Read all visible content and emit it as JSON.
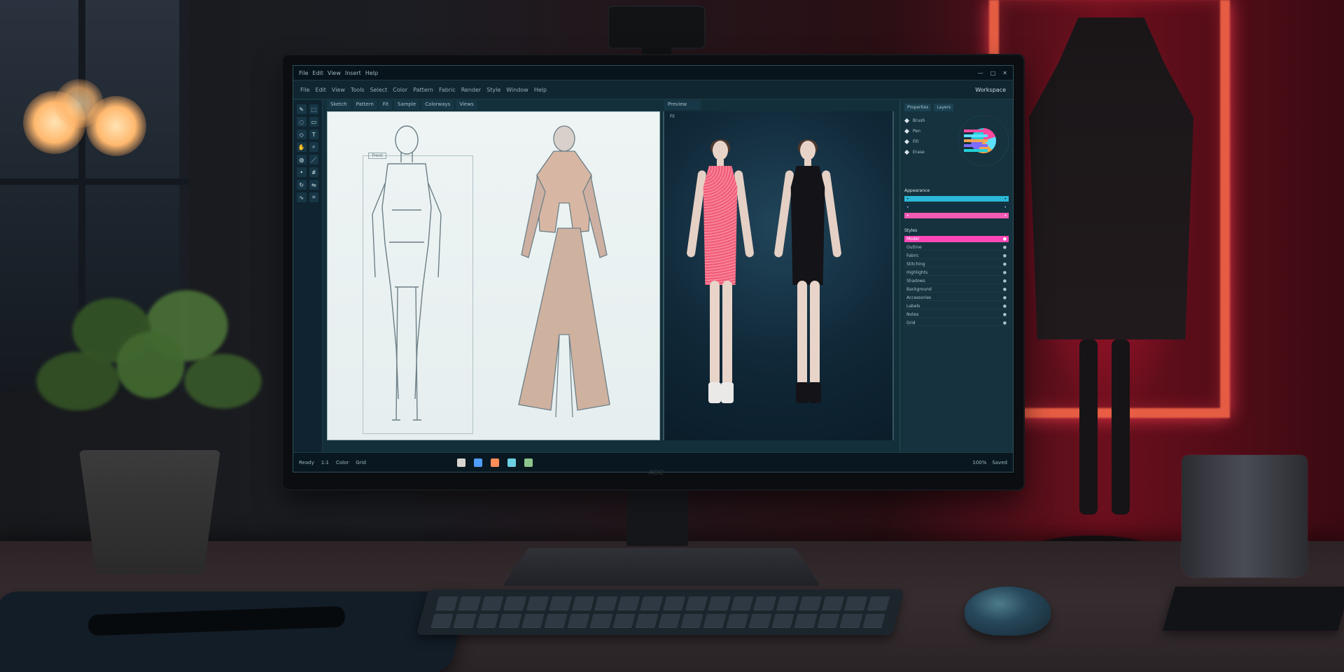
{
  "scene": {
    "accent_color": "#ff2f61",
    "screen_color": "#13303a"
  },
  "monitor": {
    "logo": "AOC"
  },
  "screen": {
    "titlebar": {
      "menu_items": [
        "File",
        "Edit",
        "View",
        "Insert",
        "Help"
      ],
      "window_controls": [
        "—",
        "□",
        "✕"
      ]
    },
    "toolbar": {
      "items": [
        "File",
        "Edit",
        "View",
        "Tools",
        "Select",
        "Color",
        "Pattern",
        "Fabric",
        "Render",
        "Style",
        "Window",
        "Help"
      ],
      "mode_label": "Workspace"
    },
    "tabs": [
      "Sketch",
      "Pattern",
      "Fit",
      "Sample",
      "Colorways",
      "Views"
    ],
    "preview_tab": "Preview",
    "sketch_label": "Front",
    "preview_label": "Fit",
    "right_panel": {
      "tabs": [
        "Properties",
        "Layers"
      ],
      "tools": [
        "Brush",
        "Pen",
        "Fill",
        "Erase"
      ],
      "section_a": "Appearance",
      "section_b": "Styles",
      "layers": [
        "Model",
        "Outline",
        "Fabric",
        "Stitching",
        "Highlights",
        "Shadows",
        "Background",
        "Accessories",
        "Labels",
        "Notes",
        "Grid"
      ]
    },
    "status": {
      "left": [
        "Ready",
        "1:1",
        "Color",
        "Grid"
      ],
      "right": [
        "100%",
        "Saved"
      ]
    }
  }
}
